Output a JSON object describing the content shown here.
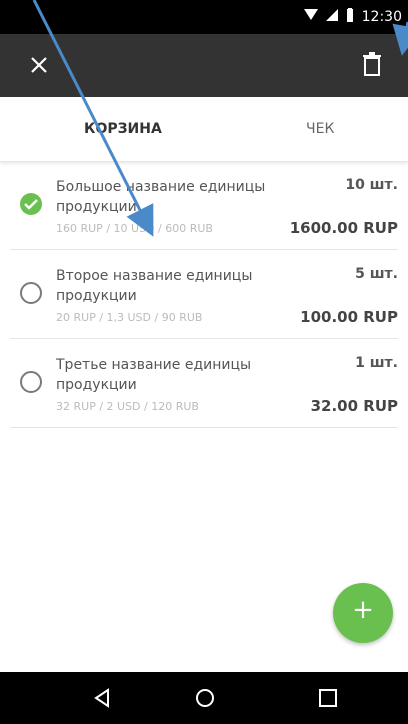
{
  "status": {
    "time": "12:30",
    "wifi_icon": "wifi-icon",
    "signal_icon": "signal-icon",
    "battery_icon": "battery-icon"
  },
  "toolbar": {
    "close_icon": "close-icon",
    "delete_icon": "trash-icon"
  },
  "tabs": [
    {
      "label": "КОРЗИНА",
      "active": true
    },
    {
      "label": "ЧЕК",
      "active": false
    }
  ],
  "items": [
    {
      "title": "Большое название единицы продукции",
      "prices": "160 RUP / 10 USD / 600 RUB",
      "qty": "10 шт.",
      "total": "1600.00 RUP",
      "checked": true
    },
    {
      "title": "Второе название единицы продукции",
      "prices": "20 RUP / 1,3 USD / 90 RUB",
      "qty": "5 шт.",
      "total": "100.00 RUP",
      "checked": false
    },
    {
      "title": "Третье название единицы продукции",
      "prices": "32 RUP / 2 USD / 120 RUB",
      "qty": "1 шт.",
      "total": "32.00 RUP",
      "checked": false
    }
  ],
  "fab": {
    "label": "+"
  },
  "nav": {
    "back_icon": "back-icon",
    "home_icon": "home-icon",
    "recents_icon": "recents-icon"
  },
  "colors": {
    "accent": "#6ac04f",
    "toolbar": "#333333",
    "annotation_arrow": "#4a8ac9"
  }
}
